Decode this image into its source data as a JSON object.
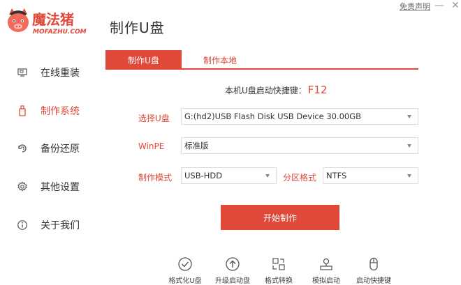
{
  "brand": {
    "logo_cn": "魔法猪",
    "logo_en": "MOFAZHU.COM"
  },
  "window": {
    "title": "制作U盘",
    "disclaimer": "免责声明",
    "minimize": "—",
    "close": "✕"
  },
  "sidebar": {
    "items": [
      {
        "label": "在线重装",
        "icon": "monitor-icon",
        "active": false
      },
      {
        "label": "制作系统",
        "icon": "usb-drive-icon",
        "active": true
      },
      {
        "label": "备份还原",
        "icon": "backup-restore-icon",
        "active": false
      },
      {
        "label": "其他设置",
        "icon": "gear-icon",
        "active": false
      },
      {
        "label": "关于我们",
        "icon": "info-icon",
        "active": false
      }
    ]
  },
  "tabs": [
    {
      "label": "制作U盘",
      "active": true
    },
    {
      "label": "制作本地",
      "active": false
    }
  ],
  "hotkey": {
    "label": "本机U盘启动快捷键：",
    "key": "F12"
  },
  "form": {
    "usb_label": "选择U盘",
    "usb_value": "G:(hd2)USB Flash Disk USB Device 30.00GB",
    "winpe_label": "WinPE",
    "winpe_value": "标准版",
    "mode_label": "制作模式",
    "mode_value": "USB-HDD",
    "partition_label": "分区格式",
    "partition_value": "NTFS"
  },
  "start_button": "开始制作",
  "tools": [
    {
      "label": "格式化U盘",
      "icon": "check-circle-icon"
    },
    {
      "label": "升级启动盘",
      "icon": "upgrade-icon"
    },
    {
      "label": "格式转换",
      "icon": "convert-icon"
    },
    {
      "label": "模拟启动",
      "icon": "simulate-icon"
    },
    {
      "label": "启动快捷键",
      "icon": "mouse-icon"
    }
  ],
  "colors": {
    "accent": "#e0483a",
    "text": "#333333",
    "border": "#dddddd"
  }
}
